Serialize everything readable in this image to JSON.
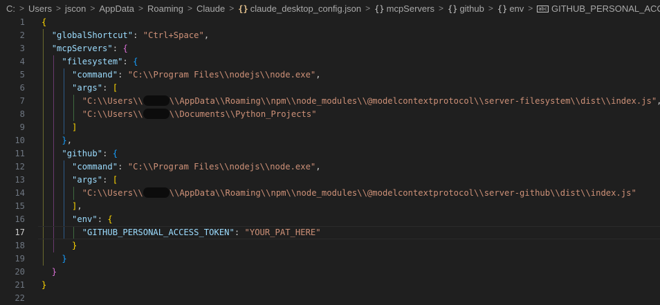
{
  "breadcrumb": {
    "items": [
      {
        "label": "C:",
        "icon": ""
      },
      {
        "label": "Users",
        "icon": ""
      },
      {
        "label": "jscon",
        "icon": ""
      },
      {
        "label": "AppData",
        "icon": ""
      },
      {
        "label": "Roaming",
        "icon": ""
      },
      {
        "label": "Claude",
        "icon": ""
      },
      {
        "label": "claude_desktop_config.json",
        "icon": "json-file-icon"
      },
      {
        "label": "mcpServers",
        "icon": "object-icon"
      },
      {
        "label": "github",
        "icon": "object-icon"
      },
      {
        "label": "env",
        "icon": "object-icon"
      },
      {
        "label": "GITHUB_PERSONAL_ACCESS_TOKEN",
        "icon": "string-icon"
      }
    ],
    "separator": ">"
  },
  "editor": {
    "current_line": 17,
    "line_numbers": [
      "1",
      "2",
      "3",
      "4",
      "5",
      "6",
      "7",
      "8",
      "9",
      "10",
      "11",
      "12",
      "13",
      "14",
      "15",
      "16",
      "17",
      "18",
      "19",
      "20",
      "21",
      "22"
    ],
    "lines": [
      [
        {
          "t": "{",
          "c": "b1"
        }
      ],
      [
        {
          "t": "  ",
          "c": "p"
        },
        {
          "t": "\"globalShortcut\"",
          "c": "k"
        },
        {
          "t": ": ",
          "c": "p"
        },
        {
          "t": "\"Ctrl+Space\"",
          "c": "s"
        },
        {
          "t": ",",
          "c": "p"
        }
      ],
      [
        {
          "t": "  ",
          "c": "p"
        },
        {
          "t": "\"mcpServers\"",
          "c": "k"
        },
        {
          "t": ": ",
          "c": "p"
        },
        {
          "t": "{",
          "c": "b2"
        }
      ],
      [
        {
          "t": "    ",
          "c": "p"
        },
        {
          "t": "\"filesystem\"",
          "c": "k"
        },
        {
          "t": ": ",
          "c": "p"
        },
        {
          "t": "{",
          "c": "b3"
        }
      ],
      [
        {
          "t": "      ",
          "c": "p"
        },
        {
          "t": "\"command\"",
          "c": "k"
        },
        {
          "t": ": ",
          "c": "p"
        },
        {
          "t": "\"C:\\\\Program Files\\\\nodejs\\\\node.exe\"",
          "c": "s"
        },
        {
          "t": ",",
          "c": "p"
        }
      ],
      [
        {
          "t": "      ",
          "c": "p"
        },
        {
          "t": "\"args\"",
          "c": "k"
        },
        {
          "t": ": ",
          "c": "p"
        },
        {
          "t": "[",
          "c": "b1"
        }
      ],
      [
        {
          "t": "        ",
          "c": "p"
        },
        {
          "t": "\"C:\\\\Users\\\\",
          "c": "s"
        },
        {
          "t": "",
          "c": "redact"
        },
        {
          "t": "\\\\AppData\\\\Roaming\\\\npm\\\\node_modules\\\\@modelcontextprotocol\\\\server-filesystem\\\\dist\\\\index.js\"",
          "c": "s"
        },
        {
          "t": ",",
          "c": "p"
        }
      ],
      [
        {
          "t": "        ",
          "c": "p"
        },
        {
          "t": "\"C:\\\\Users\\\\",
          "c": "s"
        },
        {
          "t": "",
          "c": "redact"
        },
        {
          "t": "\\\\Documents\\\\Python_Projects\"",
          "c": "s"
        }
      ],
      [
        {
          "t": "      ",
          "c": "p"
        },
        {
          "t": "]",
          "c": "b1"
        }
      ],
      [
        {
          "t": "    ",
          "c": "p"
        },
        {
          "t": "}",
          "c": "b3"
        },
        {
          "t": ",",
          "c": "p"
        }
      ],
      [
        {
          "t": "    ",
          "c": "p"
        },
        {
          "t": "\"github\"",
          "c": "k"
        },
        {
          "t": ": ",
          "c": "p"
        },
        {
          "t": "{",
          "c": "b3"
        }
      ],
      [
        {
          "t": "      ",
          "c": "p"
        },
        {
          "t": "\"command\"",
          "c": "k"
        },
        {
          "t": ": ",
          "c": "p"
        },
        {
          "t": "\"C:\\\\Program Files\\\\nodejs\\\\node.exe\"",
          "c": "s"
        },
        {
          "t": ",",
          "c": "p"
        }
      ],
      [
        {
          "t": "      ",
          "c": "p"
        },
        {
          "t": "\"args\"",
          "c": "k"
        },
        {
          "t": ": ",
          "c": "p"
        },
        {
          "t": "[",
          "c": "b1"
        }
      ],
      [
        {
          "t": "        ",
          "c": "p"
        },
        {
          "t": "\"C:\\\\Users\\\\",
          "c": "s"
        },
        {
          "t": "",
          "c": "redact"
        },
        {
          "t": "\\\\AppData\\\\Roaming\\\\npm\\\\node_modules\\\\@modelcontextprotocol\\\\server-github\\\\dist\\\\index.js\"",
          "c": "s"
        }
      ],
      [
        {
          "t": "      ",
          "c": "p"
        },
        {
          "t": "]",
          "c": "b1"
        },
        {
          "t": ",",
          "c": "p"
        }
      ],
      [
        {
          "t": "      ",
          "c": "p"
        },
        {
          "t": "\"env\"",
          "c": "k"
        },
        {
          "t": ": ",
          "c": "p"
        },
        {
          "t": "{",
          "c": "b1"
        }
      ],
      [
        {
          "t": "        ",
          "c": "p"
        },
        {
          "t": "\"GITHUB_PERSONAL_ACCESS_TOKEN\"",
          "c": "k"
        },
        {
          "t": ": ",
          "c": "p"
        },
        {
          "t": "\"YOUR_PAT_HERE\"",
          "c": "s"
        }
      ],
      [
        {
          "t": "      ",
          "c": "p"
        },
        {
          "t": "}",
          "c": "b1"
        }
      ],
      [
        {
          "t": "    ",
          "c": "p"
        },
        {
          "t": "}",
          "c": "b3"
        }
      ],
      [
        {
          "t": "  ",
          "c": "p"
        },
        {
          "t": "}",
          "c": "b2"
        }
      ],
      [
        {
          "t": "}",
          "c": "b1"
        }
      ],
      []
    ]
  },
  "colors": {
    "background": "#1f1f1f",
    "key": "#9cdcfe",
    "string": "#ce9178",
    "bracket_gold": "#ffd700",
    "bracket_purple": "#da70d6",
    "bracket_blue": "#179fff",
    "line_number": "#6e7681"
  }
}
